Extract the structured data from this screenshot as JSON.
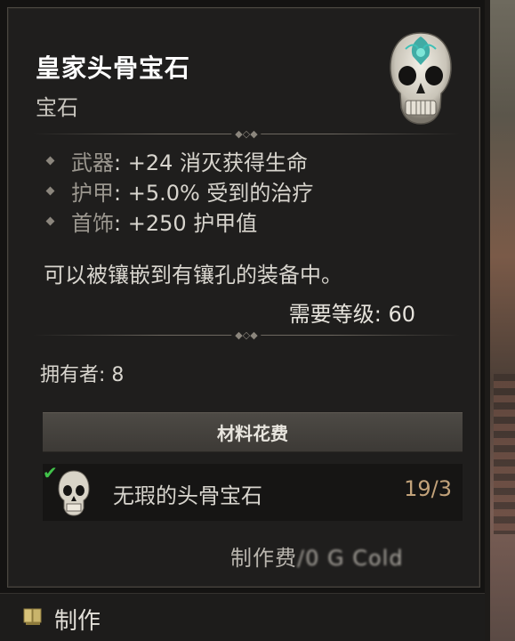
{
  "item": {
    "name": "皇家头骨宝石",
    "type": "宝石",
    "icon": "skull-gem-icon"
  },
  "affixes": [
    {
      "slot": "武器",
      "value": ": +24 消灭获得生命"
    },
    {
      "slot": "护甲",
      "value": ": +5.0% 受到的治疗"
    },
    {
      "slot": "首饰",
      "value": ": +250 护甲值"
    }
  ],
  "description": "可以被镶嵌到有镶孔的装备中。",
  "requirement": "需要等级: 60",
  "owned": "拥有者: 8",
  "materials": {
    "header": "材料花费",
    "items": [
      {
        "name": "无瑕的头骨宝石",
        "count": "19/3",
        "icon": "skull-icon",
        "status": "check-icon"
      }
    ]
  },
  "cost": {
    "label": "制作费",
    "value": "/0 G Cold"
  },
  "footer": {
    "label": "制作",
    "icon": "book-icon"
  },
  "colors": {
    "panel_bg": "#1f1e1d",
    "text_primary": "#d8d5ce",
    "count_color": "#c2a27a",
    "check_color": "#41c24a",
    "gem_accent": "#2fa6a0"
  }
}
